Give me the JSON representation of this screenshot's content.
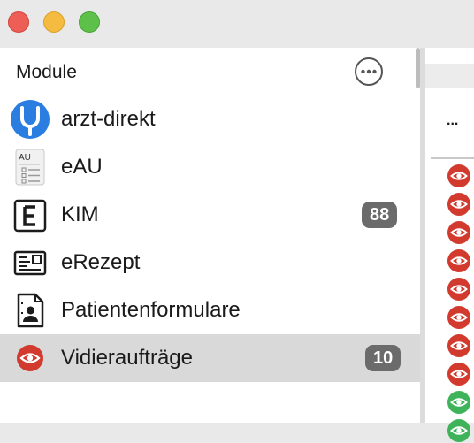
{
  "window": {
    "controls": [
      "close",
      "minimize",
      "zoom"
    ]
  },
  "sidebar": {
    "title": "Module",
    "more_icon": "ellipsis-circle-icon",
    "items": [
      {
        "label": "arzt-direkt",
        "icon": "stethoscope-icon",
        "badge": "",
        "selected": false
      },
      {
        "label": "eAU",
        "icon": "eau-document-icon",
        "badge": "",
        "selected": false
      },
      {
        "label": "KIM",
        "icon": "kim-e-icon",
        "badge": "88",
        "selected": false
      },
      {
        "label": "eRezept",
        "icon": "prescription-icon",
        "badge": "",
        "selected": false
      },
      {
        "label": "Patientenformulare",
        "icon": "patient-form-icon",
        "badge": "",
        "selected": false
      },
      {
        "label": "Vidieraufträge",
        "icon": "eye-icon",
        "badge": "10",
        "selected": true
      }
    ]
  },
  "right_pane": {
    "overflow_text": "...",
    "status_icons": [
      "red",
      "red",
      "red",
      "red",
      "red",
      "red",
      "red",
      "red",
      "green",
      "green"
    ]
  },
  "colors": {
    "accent_blue": "#2a7de1",
    "eye_red": "#d23a2e",
    "eye_green": "#3fb35a",
    "badge_gray": "#6b6b6b",
    "selection_gray": "#d9d9d9"
  }
}
